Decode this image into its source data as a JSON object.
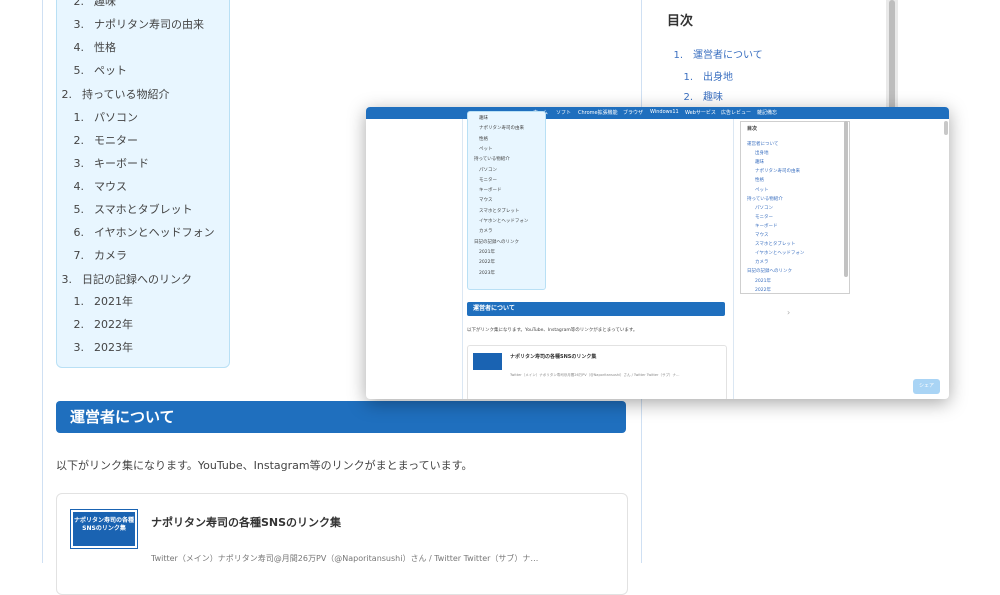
{
  "main_toc": {
    "items": [
      {
        "num": "2.",
        "label": "趣味"
      },
      {
        "num": "3.",
        "label": "ナポリタン寿司の由来"
      },
      {
        "num": "4.",
        "label": "性格"
      },
      {
        "num": "5.",
        "label": "ペット"
      },
      {
        "num": "2.",
        "label": "持っている物紹介"
      },
      {
        "num": "1.",
        "label": "パソコン"
      },
      {
        "num": "2.",
        "label": "モニター"
      },
      {
        "num": "3.",
        "label": "キーボード"
      },
      {
        "num": "4.",
        "label": "マウス"
      },
      {
        "num": "5.",
        "label": "スマホとタブレット"
      },
      {
        "num": "6.",
        "label": "イヤホンとヘッドフォン"
      },
      {
        "num": "7.",
        "label": "カメラ"
      },
      {
        "num": "3.",
        "label": "日記の記録へのリンク"
      },
      {
        "num": "1.",
        "label": "2021年"
      },
      {
        "num": "2.",
        "label": "2022年"
      },
      {
        "num": "3.",
        "label": "2023年"
      }
    ]
  },
  "section": {
    "title": "運営者について",
    "intro": "以下がリンク集になります。YouTube、Instagram等のリンクがまとまっています。"
  },
  "card": {
    "thumb": "ナポリタン寿司の各種SNSのリンク集",
    "title": "ナポリタン寿司の各種SNSのリンク集",
    "desc": "Twitter（メイン）ナポリタン寿司@月間26万PV（@Naporitansushi）さん / Twitter Twitter（サブ）ナ…"
  },
  "sidebar": {
    "title": "目次",
    "items": [
      {
        "num": "1.",
        "label": "運営者について"
      },
      {
        "num": "1.",
        "label": "出身地"
      },
      {
        "num": "2.",
        "label": "趣味"
      }
    ]
  },
  "overlay": {
    "nav": [
      "ホーム",
      "ソフト",
      "Chrome拡張機能",
      "ブラウザ",
      "Windows11",
      "Webサービス",
      "広告レビュー",
      "雑記備忘"
    ],
    "toc": [
      "趣味",
      "ナポリタン寿司の由来",
      "性格",
      "ペット",
      "持っている物紹介",
      "パソコン",
      "モニター",
      "キーボード",
      "マウス",
      "スマホとタブレット",
      "イヤホンとヘッドフォン",
      "カメラ",
      "日記の記録へのリンク",
      "2021年",
      "2022年",
      "2023年"
    ],
    "section_title": "運営者について",
    "intro": "以下がリンク集になります。YouTube、Instagram等のリンクがまとまっています。",
    "card_title": "ナポリタン寿司の各種SNSのリンク集",
    "card_desc": "Twitter（メイン）ナポリタン寿司@月間26万PV（@Naporitansushi）さん / Twitter Twitter（サブ）ナ…",
    "side_title": "目次",
    "side_items": [
      "運営者について",
      "出身地",
      "趣味",
      "ナポリタン寿司の由来",
      "性格",
      "ペット",
      "持っている物紹介",
      "パソコン",
      "モニター",
      "キーボード",
      "マウス",
      "スマホとタブレット",
      "イヤホンとヘッドフォン",
      "カメラ",
      "日記の記録へのリンク",
      "2021年",
      "2022年"
    ],
    "button": "シェア"
  }
}
